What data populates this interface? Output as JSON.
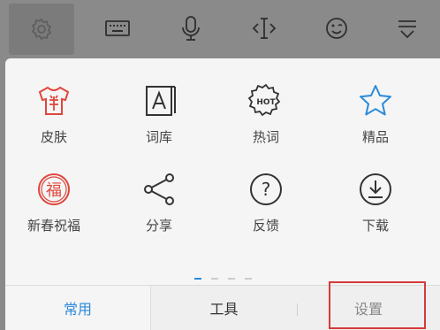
{
  "toolbar": {
    "items": [
      {
        "icon": "gear-icon"
      },
      {
        "icon": "keyboard-icon"
      },
      {
        "icon": "microphone-icon"
      },
      {
        "icon": "text-cursor-icon"
      },
      {
        "icon": "emoji-icon"
      },
      {
        "icon": "collapse-icon"
      }
    ]
  },
  "grid": {
    "items": [
      {
        "label": "皮肤",
        "icon": "skin-shirt-icon"
      },
      {
        "label": "词库",
        "icon": "dictionary-icon"
      },
      {
        "label": "热词",
        "icon": "hot-words-icon",
        "icon_text": "HOT"
      },
      {
        "label": "精品",
        "icon": "star-icon"
      },
      {
        "label": "新春祝福",
        "icon": "fortune-icon",
        "icon_text": "福"
      },
      {
        "label": "分享",
        "icon": "share-icon"
      },
      {
        "label": "反馈",
        "icon": "help-icon",
        "icon_text": "?"
      },
      {
        "label": "下载",
        "icon": "download-icon"
      }
    ]
  },
  "pager": {
    "count": 4,
    "active": 0
  },
  "tabs": {
    "items": [
      {
        "label": "常用",
        "active": true
      },
      {
        "label": "工具",
        "active": false
      },
      {
        "label": "设置",
        "active": false
      }
    ]
  },
  "colors": {
    "accent": "#2b8ad8",
    "red_icon": "#e0463c",
    "toolbar_bg": "#8a8a8a",
    "highlight": "#d63a3a"
  }
}
